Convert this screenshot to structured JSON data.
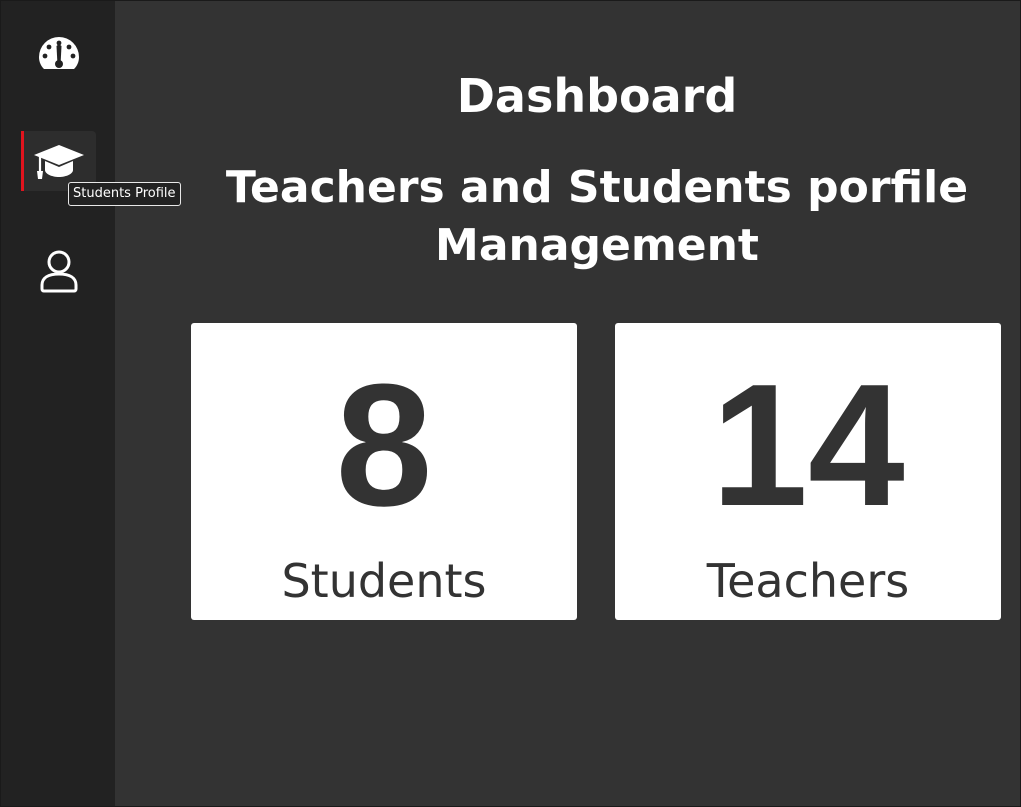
{
  "sidebar": {
    "items": [
      {
        "id": "dashboard",
        "icon": "speedometer-icon"
      },
      {
        "id": "students",
        "icon": "graduation-cap-icon",
        "active": true
      },
      {
        "id": "teachers",
        "icon": "user-icon"
      }
    ],
    "tooltip": "Students Profile"
  },
  "main": {
    "title": "Dashboard",
    "subtitle": "Teachers and Students porfile Management",
    "stats": {
      "students": {
        "count": "8",
        "label": "Students"
      },
      "teachers": {
        "count": "14",
        "label": "Teachers"
      }
    }
  },
  "colors": {
    "sidebar_bg": "#222222",
    "main_bg": "#333333",
    "card_bg": "#ffffff",
    "active_indicator": "#e0141e",
    "text_dark": "#333333"
  }
}
